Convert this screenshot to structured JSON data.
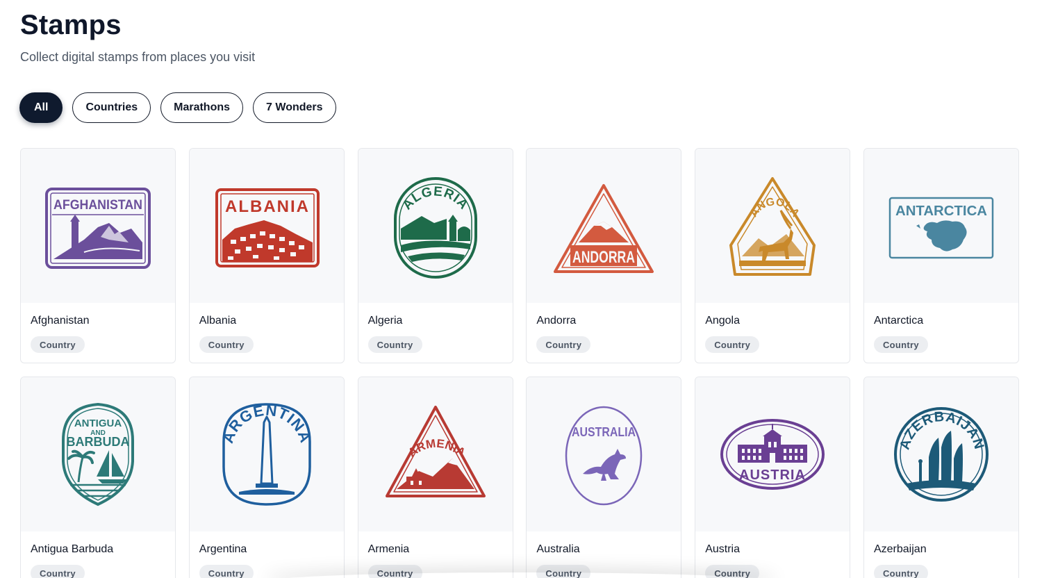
{
  "header": {
    "title": "Stamps",
    "subtitle": "Collect digital stamps from places you visit"
  },
  "filters": [
    {
      "label": "All",
      "active": true
    },
    {
      "label": "Countries",
      "active": false
    },
    {
      "label": "Marathons",
      "active": false
    },
    {
      "label": "7 Wonders",
      "active": false
    }
  ],
  "stamps": [
    {
      "name": "Afghanistan",
      "category": "Country",
      "stamp_text": "AFGHANISTAN",
      "color": "#6b4f9b",
      "icon": "mountain-tower-stamp"
    },
    {
      "name": "Albania",
      "category": "Country",
      "stamp_text": "ALBANIA",
      "color": "#c0392b",
      "icon": "hillside-town-stamp"
    },
    {
      "name": "Algeria",
      "category": "Country",
      "stamp_text": "ALGERIA",
      "color": "#1e6b4a",
      "icon": "mosque-dunes-stamp"
    },
    {
      "name": "Andorra",
      "category": "Country",
      "stamp_text": "ANDORRA",
      "color": "#d35a3f",
      "icon": "mountain-triangle-stamp"
    },
    {
      "name": "Angola",
      "category": "Country",
      "stamp_text": "ANGOLA",
      "color": "#c9892a",
      "icon": "antelope-triangle-stamp"
    },
    {
      "name": "Antarctica",
      "category": "Country",
      "stamp_text": "ANTARCTICA",
      "color": "#4a86a0",
      "icon": "continent-map-stamp"
    },
    {
      "name": "Antigua Barbuda",
      "category": "Country",
      "stamp_text_top": "ANTIGUA",
      "stamp_text_mid": "AND",
      "stamp_text_bottom": "BARBUDA",
      "color": "#2d7a78",
      "icon": "palm-sailboat-stamp"
    },
    {
      "name": "Argentina",
      "category": "Country",
      "stamp_text": "ARGENTINA",
      "color": "#1f5f9e",
      "icon": "obelisk-stamp"
    },
    {
      "name": "Armenia",
      "category": "Country",
      "stamp_text": "ARMENIA",
      "color": "#b83a33",
      "icon": "church-mountain-stamp"
    },
    {
      "name": "Australia",
      "category": "Country",
      "stamp_text": "AUSTRALIA",
      "color": "#7b66b8",
      "icon": "kangaroo-stamp"
    },
    {
      "name": "Austria",
      "category": "Country",
      "stamp_text": "AUSTRIA",
      "color": "#6a3f93",
      "icon": "palace-stamp"
    },
    {
      "name": "Azerbaijan",
      "category": "Country",
      "stamp_text": "AZERBAIJAN",
      "color": "#1d5a78",
      "icon": "flame-towers-stamp"
    }
  ]
}
